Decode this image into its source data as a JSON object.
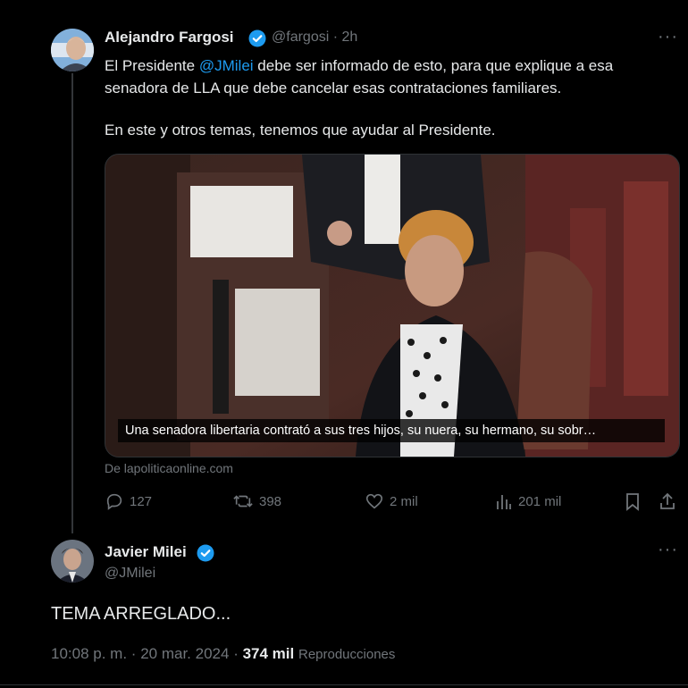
{
  "tweet1": {
    "author_name": "Alejandro Fargosi",
    "handle": "@fargosi",
    "separator": "·",
    "time": "2h",
    "text_before": "El Presidente ",
    "mention": "@JMilei",
    "text_after": " debe ser informado de esto, para que explique a esa senadora de LLA que debe cancelar esas contrataciones familiares.",
    "text_para2": "En este y otros temas, tenemos que ayudar al Presidente.",
    "media_caption": "Una senadora libertaria contrató a sus tres hijos, su nuera, su hermano, su sobr…",
    "source": "De lapoliticaonline.com",
    "replies": "127",
    "retweets": "398",
    "likes": "2 mil",
    "views": "201 mil",
    "more": "···"
  },
  "tweet2": {
    "author_name": "Javier Milei",
    "handle": "@JMilei",
    "text": "TEMA ARREGLADO...",
    "time": "10:08 p. m.",
    "separator": "·",
    "date": "20 mar. 2024",
    "separator2": "·",
    "views_count": "374 mil",
    "views_label": "Reproducciones",
    "more": "···"
  },
  "colors": {
    "background": "#000000",
    "text": "#e7e9ea",
    "muted": "#71767b",
    "accent": "#1d9bf0"
  }
}
